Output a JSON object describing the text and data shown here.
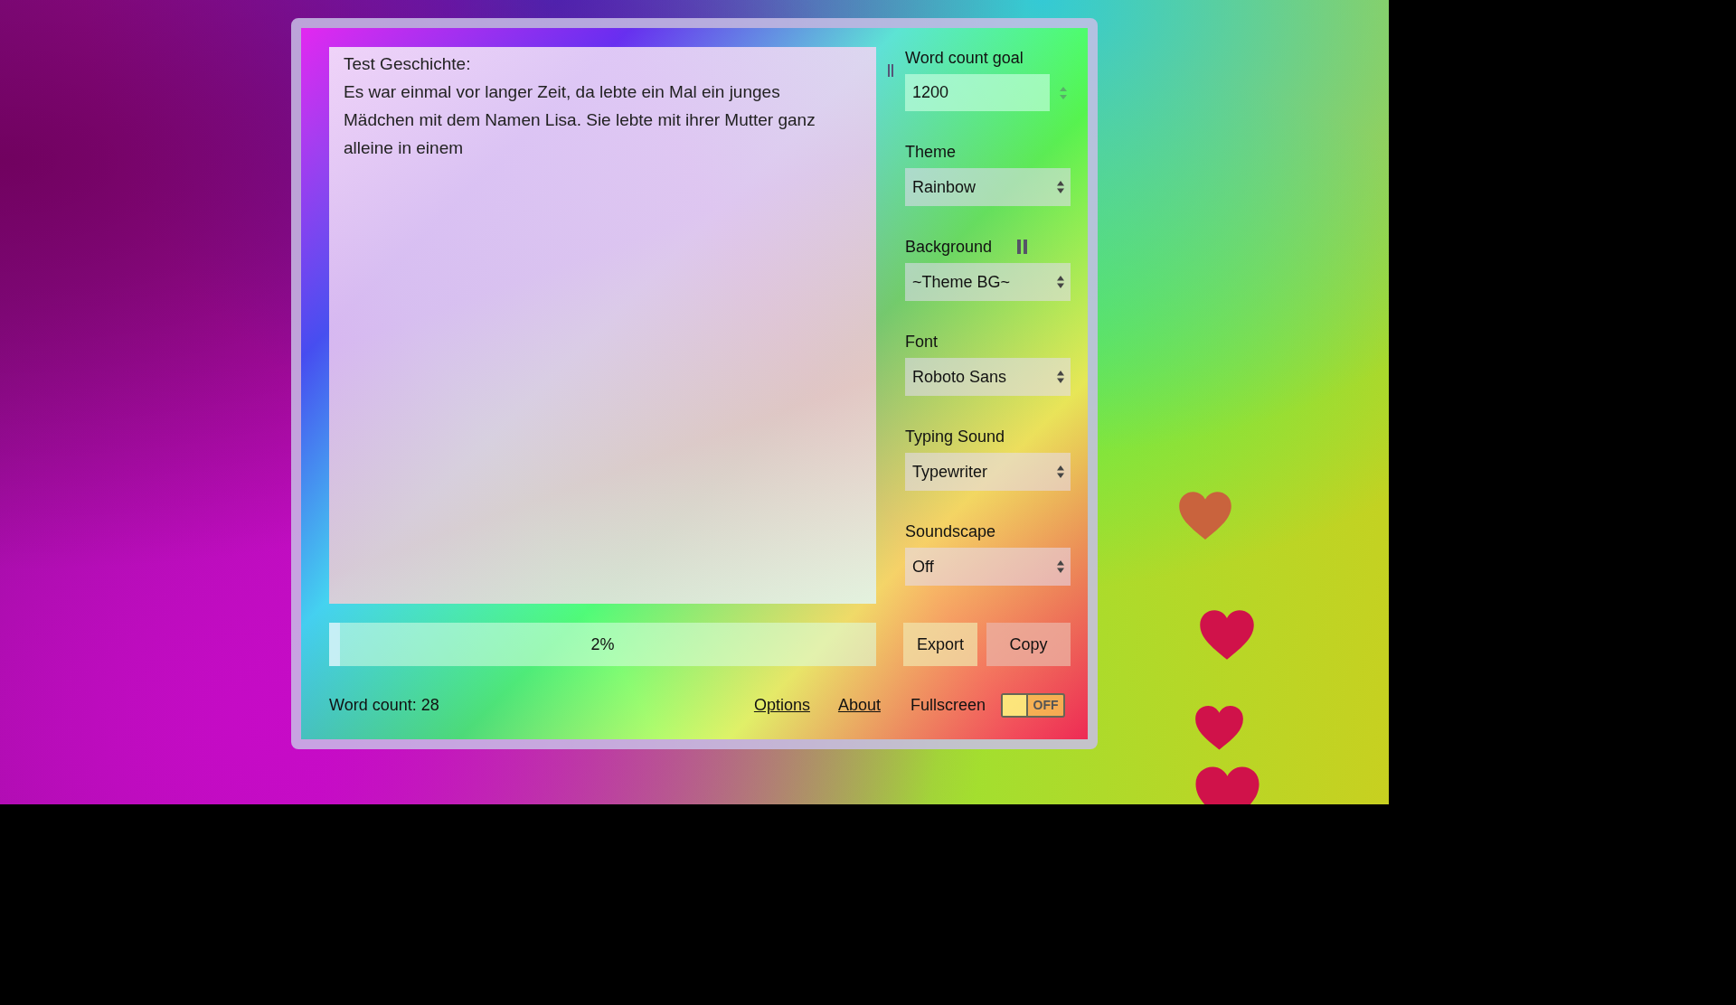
{
  "editor": {
    "text": "Test Geschichte:\nEs war einmal vor langer Zeit, da lebte ein Mal ein junges Mädchen mit dem Namen Lisa. Sie lebte mit ihrer Mutter ganz alleine in einem"
  },
  "settings": [
    {
      "kind": "number",
      "label": "Word count goal",
      "value": "1200",
      "pause_button": false
    },
    {
      "kind": "select",
      "label": "Theme",
      "value": "Rainbow",
      "pause_button": false
    },
    {
      "kind": "select",
      "label": "Background",
      "value": "~Theme BG~",
      "pause_button": true
    },
    {
      "kind": "select",
      "label": "Font",
      "value": "Roboto Sans",
      "pause_button": false
    },
    {
      "kind": "select",
      "label": "Typing Sound",
      "value": "Typewriter",
      "pause_button": false
    },
    {
      "kind": "select",
      "label": "Soundscape",
      "value": "Off",
      "pause_button": false
    }
  ],
  "progress": {
    "level": 0.02,
    "label": "2%"
  },
  "buttons": [
    "Export",
    "Copy"
  ],
  "footer": {
    "word_count": "Word count: 28",
    "links": [
      "Options",
      "About"
    ],
    "fullscreen": {
      "label": "Fullscreen",
      "on": false,
      "state_text": "OFF"
    }
  },
  "hearts": [
    {
      "color": "#c9633d"
    },
    {
      "color": "#d0124a"
    },
    {
      "color": "#d0124a"
    },
    {
      "color": "#d0124a"
    }
  ]
}
